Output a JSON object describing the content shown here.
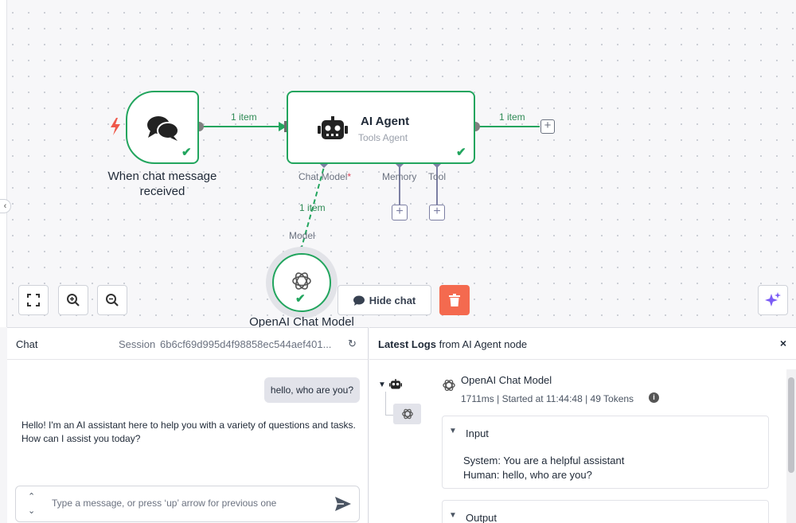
{
  "canvas": {
    "trigger_node": {
      "title": "When chat message received"
    },
    "agent_node": {
      "title": "AI Agent",
      "subtitle": "Tools Agent"
    },
    "openai_node": {
      "title": "OpenAI Chat Model",
      "port_label": "Model"
    },
    "edges": {
      "trigger_to_agent": "1 item",
      "agent_out": "1 item",
      "model_to_agent": "1 item"
    },
    "ports": {
      "chat_model": "Chat Model",
      "required_marker": "*",
      "memory": "Memory",
      "tool": "Tool"
    },
    "toolbar": {
      "hide_chat_label": "Hide chat"
    },
    "colors": {
      "success": "#22a55e",
      "port": "#7c7fa3",
      "danger": "#f46a4f",
      "trigger": "#ef5a4c",
      "ai": "#7b5cf5"
    }
  },
  "chat": {
    "title": "Chat",
    "session_label": "Session",
    "session_id": "6b6cf69d995d4f98858ec544aef401...",
    "messages": {
      "user": "hello, who are you?",
      "bot": "Hello! I'm an AI assistant here to help you with a variety of questions and tasks. How can I assist you today?"
    },
    "input_placeholder": "Type a message, or press ‘up’ arrow for previous one"
  },
  "logs": {
    "title_bold": "Latest Logs",
    "title_rest": " from AI Agent node",
    "run": {
      "title": "OpenAI Chat Model",
      "meta": "1711ms | Started at 11:44:48 | 49 Tokens"
    },
    "input_section": {
      "title": "Input",
      "lines": [
        "System: You are a helpful assistant",
        "Human: hello, who are you?"
      ]
    },
    "output_section": {
      "title": "Output"
    }
  }
}
